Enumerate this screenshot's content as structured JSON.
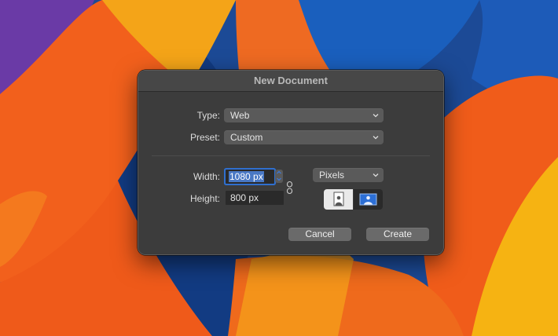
{
  "dialog": {
    "title": "New Document",
    "type_label": "Type:",
    "type_value": "Web",
    "preset_label": "Preset:",
    "preset_value": "Custom",
    "width_label": "Width:",
    "width_value_selected": "1080 px",
    "height_label": "Height:",
    "height_value": "800 px",
    "units_value": "Pixels",
    "orientation_selected": "landscape",
    "cancel_label": "Cancel",
    "create_label": "Create"
  },
  "colors": {
    "dialog_bg": "#3c3c3c",
    "accent": "#2f6fcf",
    "wallpaper_blue": "#1a4d9c",
    "wallpaper_orange": "#f05a1e",
    "wallpaper_yellow": "#f6b312"
  }
}
